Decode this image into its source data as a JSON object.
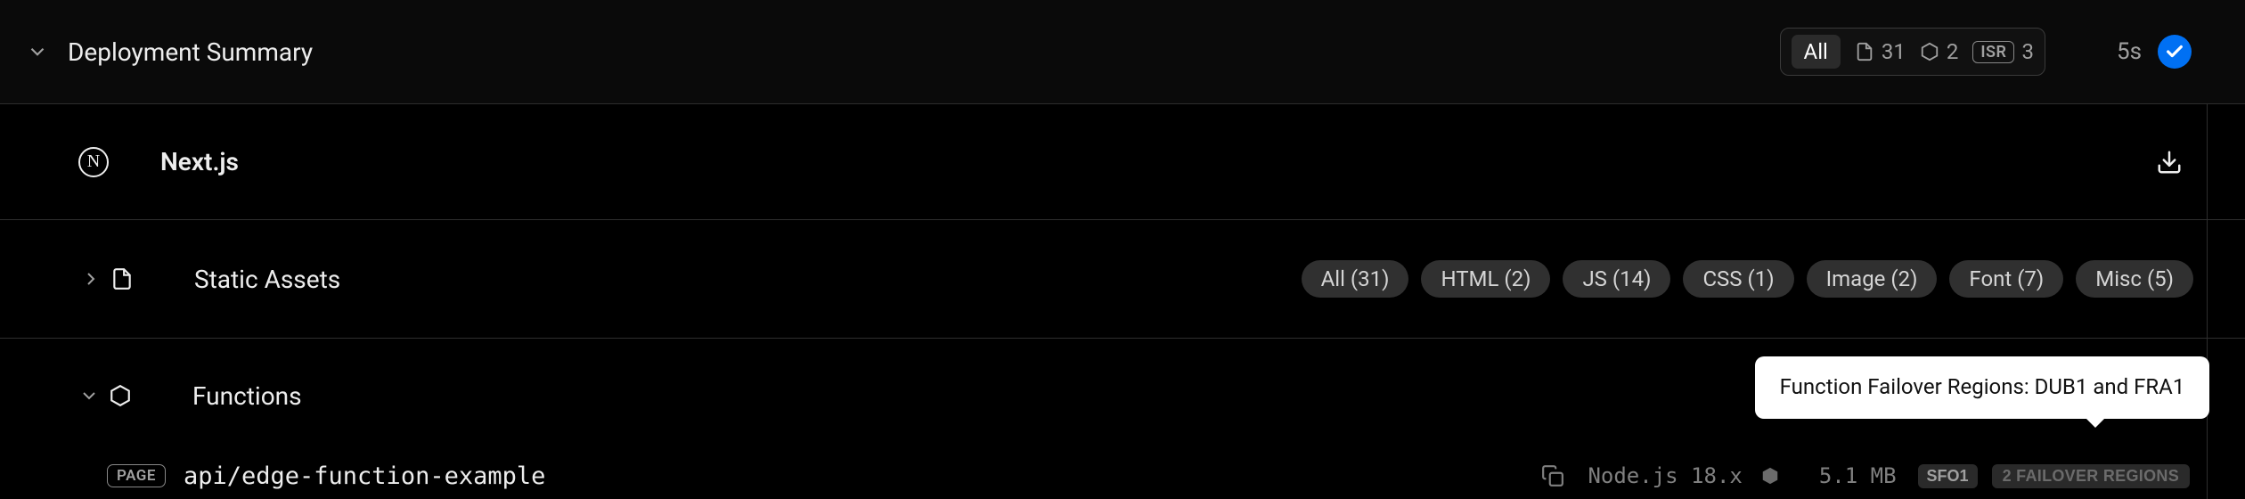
{
  "summary": {
    "title": "Deployment Summary",
    "filter_all": "All",
    "pages_count": "31",
    "functions_count": "2",
    "isr_label": "ISR",
    "isr_count": "3",
    "build_time": "5s"
  },
  "framework": {
    "name": "Next.js",
    "logo_letter": "N"
  },
  "assets": {
    "label": "Static Assets",
    "tags": [
      "All (31)",
      "HTML (2)",
      "JS (14)",
      "CSS (1)",
      "Image (2)",
      "Font (7)",
      "Misc (5)"
    ]
  },
  "functions": {
    "label": "Functions",
    "items": [
      {
        "badge": "PAGE",
        "path": "api/edge-function-example",
        "runtime": "Node.js 18.x",
        "size": "5.1 MB",
        "region": "SFO1",
        "failover_label": "2 FAILOVER REGIONS"
      }
    ]
  },
  "tooltip": "Function Failover Regions: DUB1 and FRA1"
}
